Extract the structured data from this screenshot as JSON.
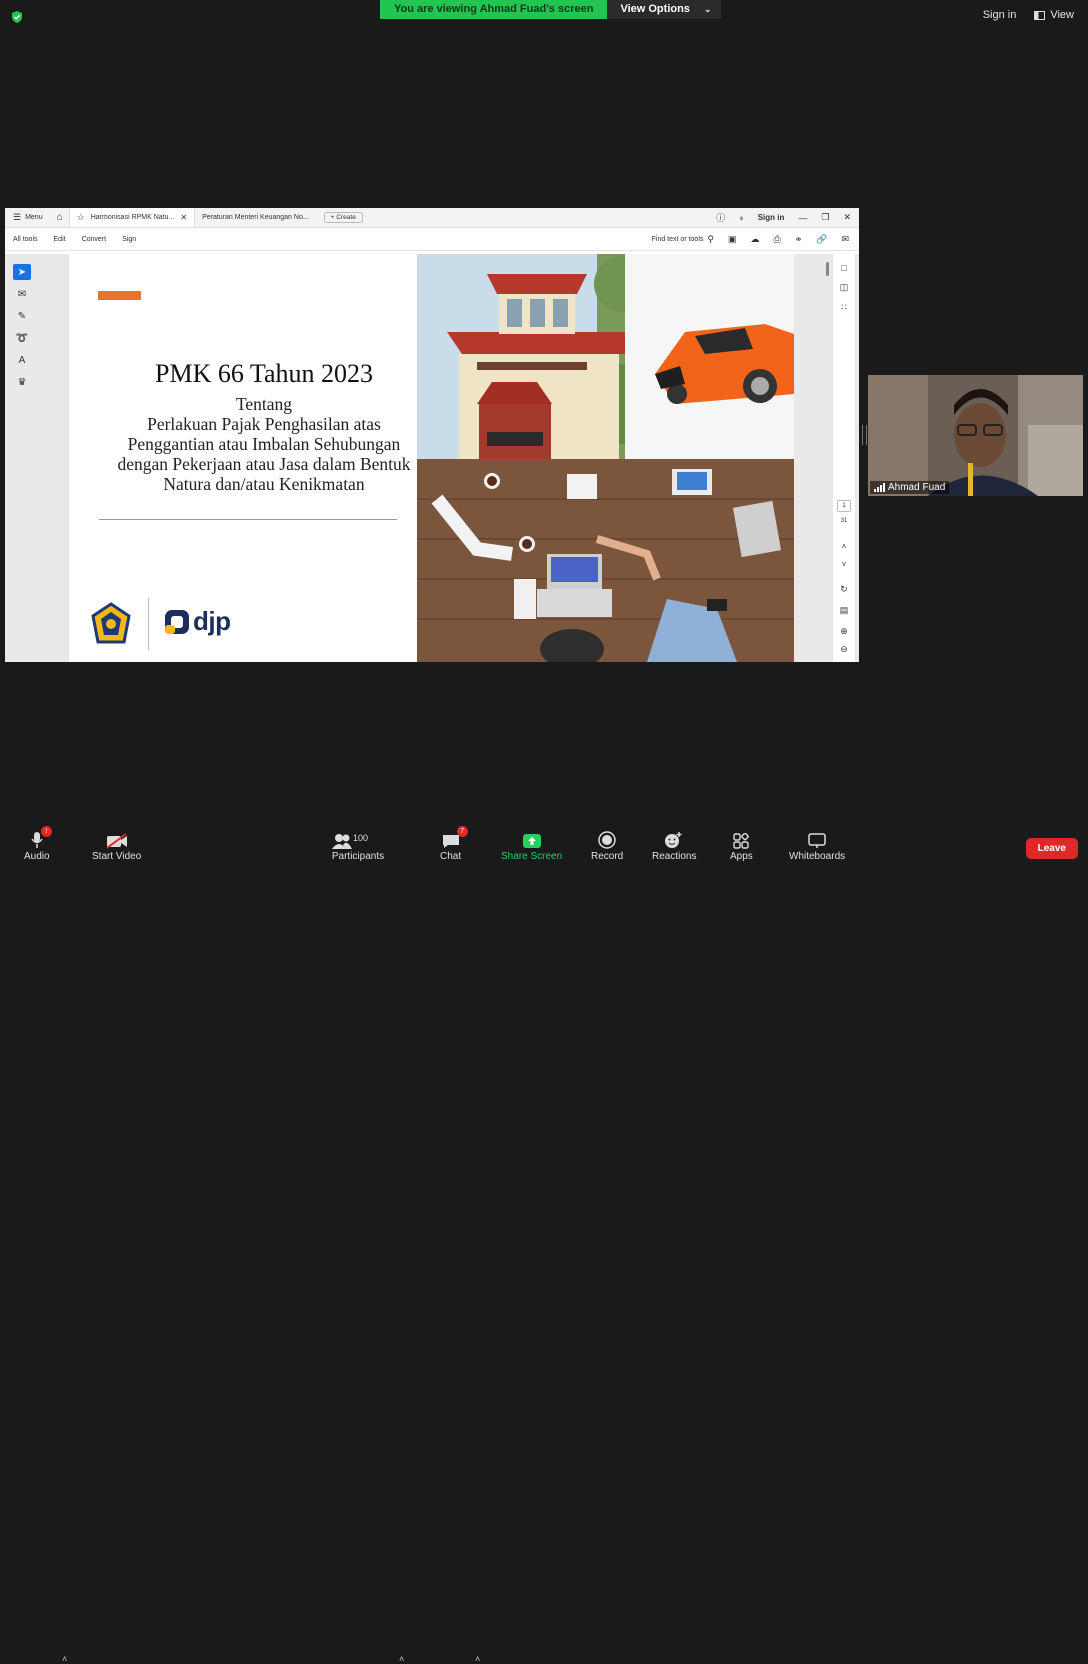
{
  "zoom_top": {
    "viewing_banner": "You are viewing Ahmad Fuad's screen",
    "view_options": "View Options",
    "sign_in": "Sign in",
    "view": "View"
  },
  "acrobat": {
    "menu_label": "Menu",
    "tabs": [
      {
        "label": "Harmonisasi RPMK Natu..."
      },
      {
        "label": "Peraturan Menteri Keuangan No..."
      }
    ],
    "create_label": "Create",
    "sign_in": "Sign in",
    "toolbar": [
      "All tools",
      "Edit",
      "Convert",
      "Sign"
    ],
    "find_label": "Find text or tools",
    "page_current": "1",
    "page_total": "31"
  },
  "slide": {
    "title": "PMK 66 Tahun 2023",
    "subtitle_lines": [
      "Tentang",
      "Perlakuan Pajak Penghasilan atas",
      "Penggantian atau Imbalan Sehubungan",
      "dengan Pekerjaan atau Jasa dalam Bentuk",
      "Natura dan/atau Kenikmatan"
    ],
    "logo_text": "djp"
  },
  "participant": {
    "name": "Ahmad Fuad"
  },
  "controls": {
    "audio": "Audio",
    "audio_badge": "!",
    "start_video": "Start Video",
    "participants": "Participants",
    "participants_count": "100",
    "chat": "Chat",
    "chat_badge": "7",
    "share_screen": "Share Screen",
    "record": "Record",
    "reactions": "Reactions",
    "apps": "Apps",
    "whiteboards": "Whiteboards",
    "leave": "Leave"
  },
  "colors": {
    "banner_green": "#23c552",
    "share_green": "#23d160",
    "leave_red": "#e02828",
    "slide_orange": "#e8732c",
    "acrobat_blue": "#1473e6"
  }
}
